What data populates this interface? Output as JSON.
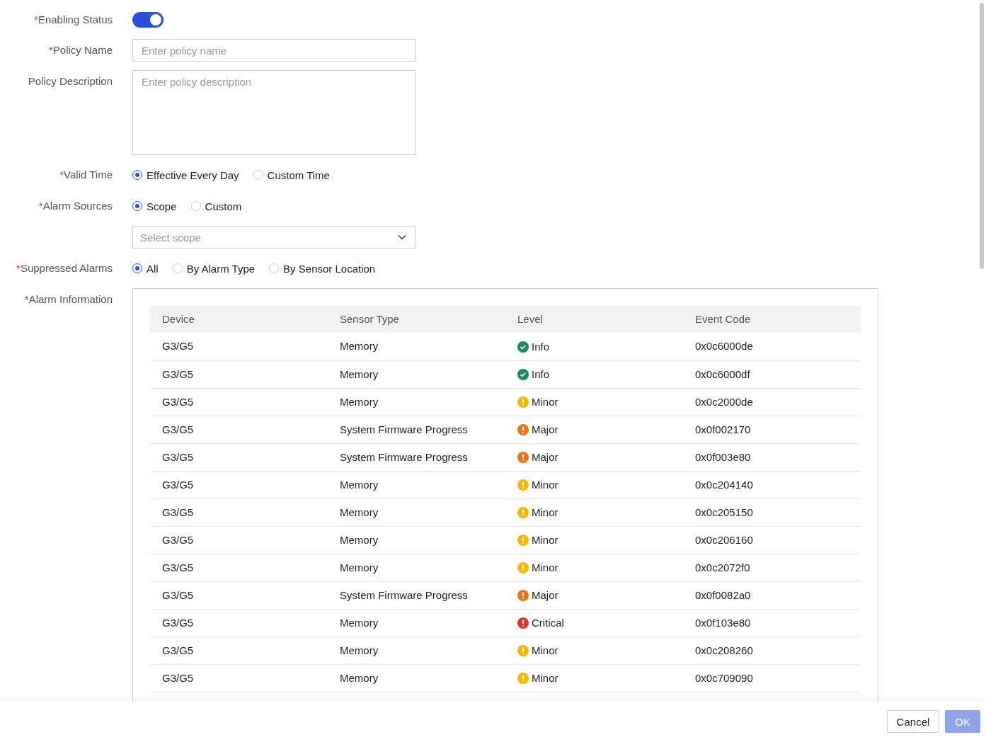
{
  "form": {
    "enabling_status": {
      "label": "Enabling Status",
      "required_mark": "*",
      "on": true
    },
    "policy_name": {
      "label": "Policy Name",
      "required_mark": "*",
      "placeholder": "Enter policy name"
    },
    "policy_description": {
      "label": "Policy Description",
      "placeholder": "Enter policy description"
    },
    "valid_time": {
      "label": "Valid Time",
      "required_mark": "*",
      "options": [
        {
          "label": "Effective Every Day",
          "selected": true
        },
        {
          "label": "Custom Time",
          "selected": false
        }
      ]
    },
    "alarm_sources": {
      "label": "Alarm Sources",
      "required_mark": "*",
      "options": [
        {
          "label": "Scope",
          "selected": true
        },
        {
          "label": "Custom",
          "selected": false
        }
      ],
      "scope_select": {
        "placeholder": "Select scope"
      }
    },
    "suppressed_alarms": {
      "label": "Suppressed Alarms",
      "required_mark": "*",
      "options": [
        {
          "label": "All",
          "selected": true
        },
        {
          "label": "By Alarm Type",
          "selected": false
        },
        {
          "label": "By Sensor Location",
          "selected": false
        }
      ]
    },
    "alarm_information": {
      "label": "Alarm Information",
      "required_mark": "*",
      "table": {
        "columns": [
          "Device",
          "Sensor Type",
          "Level",
          "Event Code"
        ],
        "rows": [
          {
            "device": "G3/G5",
            "sensor_type": "Memory",
            "kind": "check",
            "color": "#1e8a5a",
            "level_text": "Info",
            "event_code": "0x0c6000de"
          },
          {
            "device": "G3/G5",
            "sensor_type": "Memory",
            "kind": "check",
            "color": "#1e8a5a",
            "level_text": "Info",
            "event_code": "0x0c6000df"
          },
          {
            "device": "G3/G5",
            "sensor_type": "Memory",
            "kind": "alert",
            "color": "#f5b800",
            "level_text": "Minor",
            "event_code": "0x0c2000de"
          },
          {
            "device": "G3/G5",
            "sensor_type": "System Firmware Progress",
            "kind": "alert",
            "color": "#e8741c",
            "level_text": "Major",
            "event_code": "0x0f002170"
          },
          {
            "device": "G3/G5",
            "sensor_type": "System Firmware Progress",
            "kind": "alert",
            "color": "#e8741c",
            "level_text": "Major",
            "event_code": "0x0f003e80"
          },
          {
            "device": "G3/G5",
            "sensor_type": "Memory",
            "kind": "alert",
            "color": "#f5b800",
            "level_text": "Minor",
            "event_code": "0x0c204140"
          },
          {
            "device": "G3/G5",
            "sensor_type": "Memory",
            "kind": "alert",
            "color": "#f5b800",
            "level_text": "Minor",
            "event_code": "0x0c205150"
          },
          {
            "device": "G3/G5",
            "sensor_type": "Memory",
            "kind": "alert",
            "color": "#f5b800",
            "level_text": "Minor",
            "event_code": "0x0c206160"
          },
          {
            "device": "G3/G5",
            "sensor_type": "Memory",
            "kind": "alert",
            "color": "#f5b800",
            "level_text": "Minor",
            "event_code": "0x0c2072f0"
          },
          {
            "device": "G3/G5",
            "sensor_type": "System Firmware Progress",
            "kind": "alert",
            "color": "#e8741c",
            "level_text": "Major",
            "event_code": "0x0f0082a0"
          },
          {
            "device": "G3/G5",
            "sensor_type": "Memory",
            "kind": "alert",
            "color": "#d9372d",
            "level_text": "Critical",
            "event_code": "0x0f103e80"
          },
          {
            "device": "G3/G5",
            "sensor_type": "Memory",
            "kind": "alert",
            "color": "#f5b800",
            "level_text": "Minor",
            "event_code": "0x0c208260"
          },
          {
            "device": "G3/G5",
            "sensor_type": "Memory",
            "kind": "alert",
            "color": "#f5b800",
            "level_text": "Minor",
            "event_code": "0x0c709090"
          }
        ]
      }
    }
  },
  "footer": {
    "buttons": [
      {
        "label": "Cancel",
        "kind": "secondary",
        "disabled": false
      },
      {
        "label": "OK",
        "kind": "primary",
        "disabled": true
      }
    ]
  }
}
